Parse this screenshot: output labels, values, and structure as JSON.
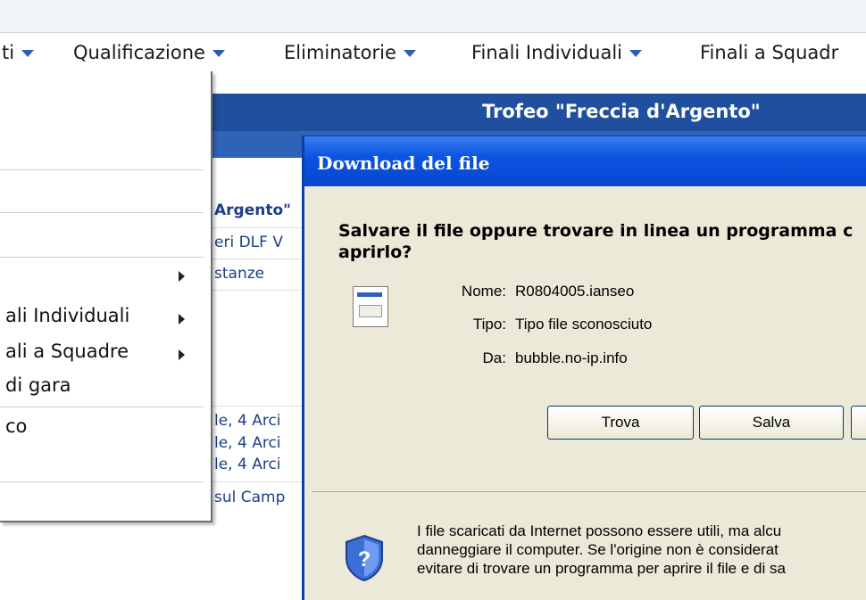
{
  "menubar": {
    "items": [
      {
        "label": "ti"
      },
      {
        "label": "Qualificazione"
      },
      {
        "label": "Eliminatorie"
      },
      {
        "label": "Finali Individuali"
      },
      {
        "label": "Finali a Squadr"
      }
    ]
  },
  "page": {
    "title": "Trofeo \"Freccia d'Argento\"",
    "content_lines": [
      "Argento\"",
      "eri DLF V",
      "stanze",
      "le, 4 Arci",
      "le, 4 Arci",
      "le, 4 Arci",
      "sul Camp"
    ]
  },
  "dropdown": {
    "items": [
      {
        "label": "ali Individuali"
      },
      {
        "label": "ali a Squadre"
      },
      {
        "label": "di gara"
      },
      {
        "label": "co"
      }
    ]
  },
  "dialog": {
    "title": "Download del file",
    "question": "Salvare il file oppure trovare in linea un programma c aprirlo?",
    "fields": [
      {
        "label": "Nome:",
        "value": "R0804005.ianseo"
      },
      {
        "label": "Tipo:",
        "value": "Tipo file sconosciuto"
      },
      {
        "label": "Da:",
        "value": "bubble.no-ip.info"
      }
    ],
    "buttons": {
      "find": "Trova",
      "save": "Salva"
    },
    "warning_lines": [
      "I file scaricati da Internet possono essere utili, ma alcu",
      "danneggiare il computer. Se l'origine non è considerat",
      "evitare di trovare un programma per aprire il file e di sa"
    ]
  },
  "colors": {
    "titlebar": "#1f4f9e",
    "dialog_title": "#0b55e0",
    "dialog_bg": "#ece9d8"
  },
  "icons": {
    "file": "unknown-file-icon",
    "warning": "security-shield-icon",
    "menu_arrow": "triangle-down-icon",
    "submenu_arrow": "triangle-right-icon"
  }
}
